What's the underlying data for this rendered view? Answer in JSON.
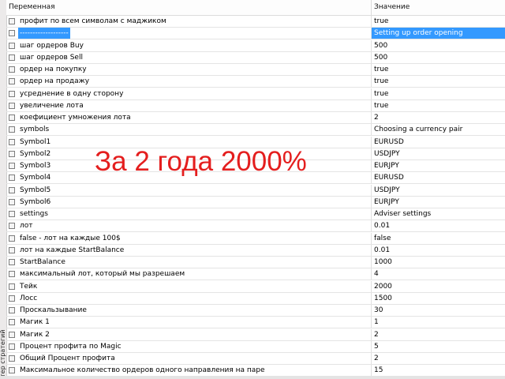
{
  "window": {
    "side_tab_label": "тер стратегий"
  },
  "table": {
    "columns": {
      "name": "Переменная",
      "value": "Значение"
    },
    "rows": [
      {
        "name": "профит по всем символам с маджиком",
        "value": "true"
      },
      {
        "name": "-------------------",
        "value": "Setting up order opening",
        "selected": true
      },
      {
        "name": "шаг ордеров Buy",
        "value": "500"
      },
      {
        "name": "шаг ордеров Sell",
        "value": "500"
      },
      {
        "name": "ордер на покупку",
        "value": "true"
      },
      {
        "name": "ордер на продажу",
        "value": "true"
      },
      {
        "name": "усреднение в одну сторону",
        "value": "true"
      },
      {
        "name": "увеличение лота",
        "value": "true"
      },
      {
        "name": "коефициент умножения лота",
        "value": "2"
      },
      {
        "name": "symbols",
        "value": "Choosing a currency pair"
      },
      {
        "name": "Symbol1",
        "value": "EURUSD"
      },
      {
        "name": "Symbol2",
        "value": "USDJPY"
      },
      {
        "name": "Symbol3",
        "value": "EURJPY"
      },
      {
        "name": "Symbol4",
        "value": "EURUSD"
      },
      {
        "name": "Symbol5",
        "value": "USDJPY"
      },
      {
        "name": "Symbol6",
        "value": "EURJPY"
      },
      {
        "name": "settings",
        "value": "Adviser settings"
      },
      {
        "name": "лот",
        "value": "0.01"
      },
      {
        "name": "false - лот на каждые 100$",
        "value": "false"
      },
      {
        "name": "лот на каждые StartBalance",
        "value": "0.01"
      },
      {
        "name": "StartBalance",
        "value": "1000"
      },
      {
        "name": "максимальный лот, который мы разрешаем",
        "value": "4"
      },
      {
        "name": "Тейк",
        "value": "2000"
      },
      {
        "name": "Лосс",
        "value": "1500"
      },
      {
        "name": "Проскальзывание",
        "value": "30"
      },
      {
        "name": "Магик 1",
        "value": "1"
      },
      {
        "name": "Магик 2",
        "value": "2"
      },
      {
        "name": "Процент профита по Magic",
        "value": "5"
      },
      {
        "name": "Общий Процент профита",
        "value": "2"
      },
      {
        "name": "Максимальное количество ордеров одного направления на паре",
        "value": "15"
      }
    ]
  },
  "overlay": {
    "text": "За 2 года 2000%",
    "color": "#e41e1e"
  },
  "colors": {
    "selection": "#3399ff",
    "grid_line": "#e4e4e4"
  }
}
